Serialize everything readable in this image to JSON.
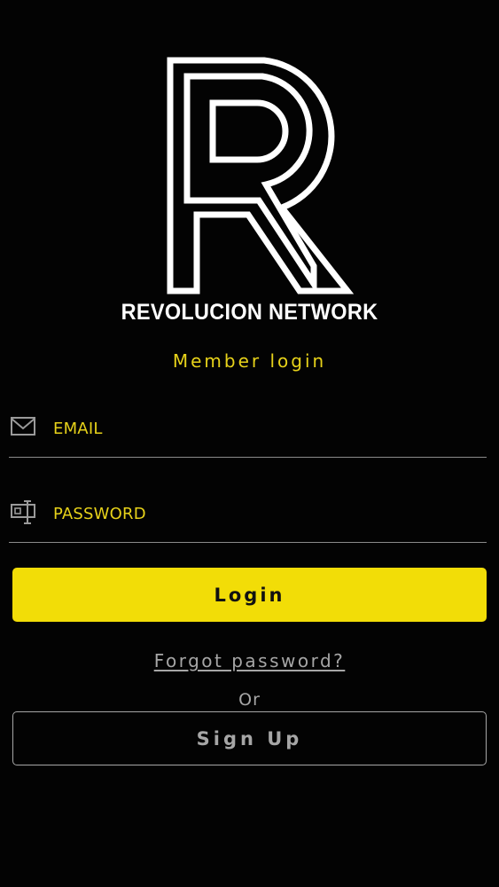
{
  "brand": {
    "name": "REVOLUCION NETWORK",
    "logo_icon": "r-logo-icon"
  },
  "login": {
    "subtitle": "Member login",
    "email_placeholder": "EMAIL",
    "email_icon": "mail-icon",
    "password_placeholder": "PASSWORD",
    "password_icon": "password-field-icon",
    "login_label": "Login",
    "forgot_label": "Forgot password?",
    "or_label": "Or",
    "signup_label": "Sign Up"
  },
  "colors": {
    "background": "#030303",
    "accent": "#f2dd07",
    "accent_text": "#e7d21a",
    "muted": "#a6a6a6"
  }
}
